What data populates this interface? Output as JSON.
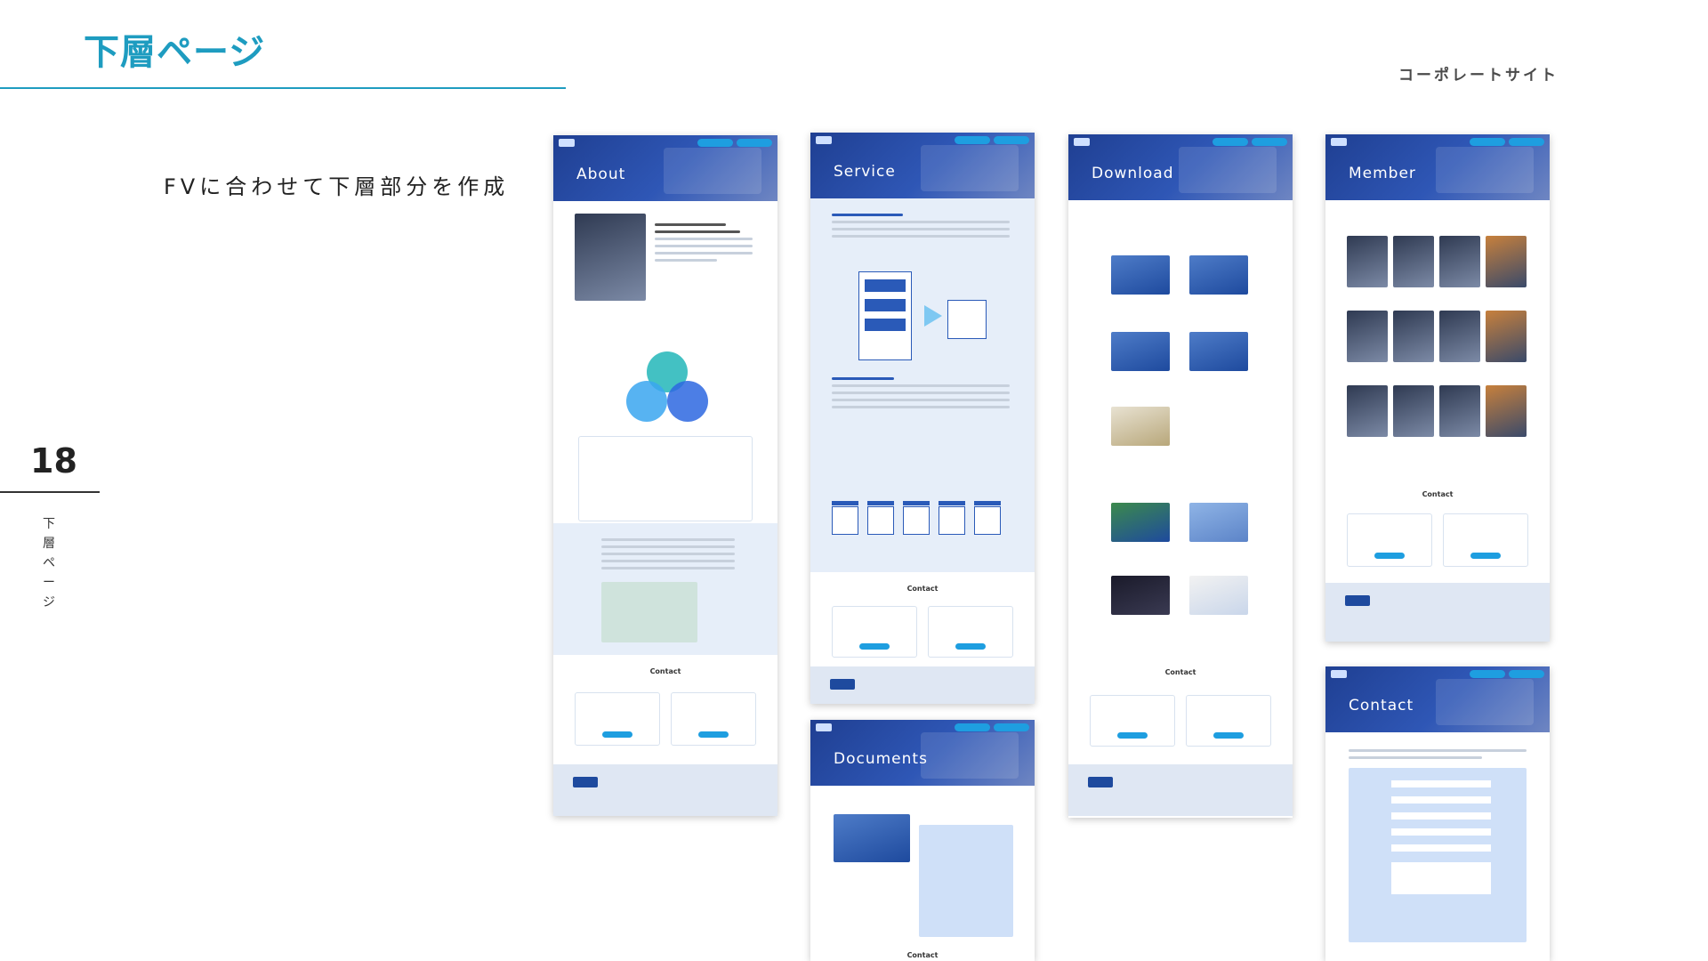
{
  "slide": {
    "title": "下層ページ",
    "subtitle": "コーポレートサイト",
    "caption": "FVに合わせて下層部分を作成",
    "page_number": "18",
    "side_label": "下\n層\nペ\nー\nジ"
  },
  "mockups": {
    "about": {
      "hero": "About",
      "contact": "Contact"
    },
    "service": {
      "hero": "Service",
      "contact": "Contact"
    },
    "documents": {
      "hero": "Documents",
      "contact": "Contact"
    },
    "download": {
      "hero": "Download",
      "contact": "Contact"
    },
    "member": {
      "hero": "Member",
      "contact": "Contact"
    },
    "contact": {
      "hero": "Contact"
    }
  },
  "colors": {
    "accent": "#1e9cc0",
    "hero": "#2f57b6",
    "button": "#1e9ee0"
  }
}
